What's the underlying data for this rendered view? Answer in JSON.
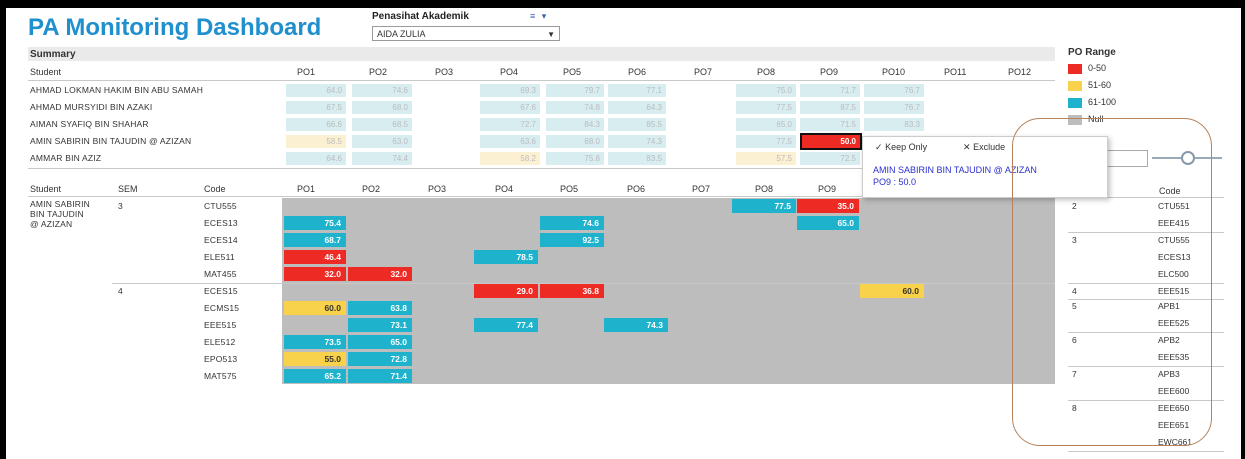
{
  "title": "PA Monitoring Dashboard",
  "filter": {
    "label": "Penasihat Akademik",
    "value": "AIDA ZULIA"
  },
  "summary": {
    "title": "Summary",
    "columns": [
      "Student",
      "PO1",
      "PO2",
      "PO3",
      "PO4",
      "PO5",
      "PO6",
      "PO7",
      "PO8",
      "PO9",
      "PO10",
      "PO11",
      "PO12"
    ],
    "rows": [
      {
        "name": "AHMAD LOKMAN HAKIM BIN ABU SAMAH",
        "values": [
          "64.0",
          "74.6",
          "",
          "69.3",
          "79.7",
          "77.1",
          "",
          "75.0",
          "71.7",
          "76.7",
          "",
          ""
        ]
      },
      {
        "name": "AHMAD MURSYIDI BIN AZAKI",
        "values": [
          "67.5",
          "68.0",
          "",
          "67.6",
          "74.8",
          "64.3",
          "",
          "77.5",
          "87.5",
          "76.7",
          "",
          ""
        ]
      },
      {
        "name": "AIMAN SYAFIQ BIN SHAHAR",
        "values": [
          "66.6",
          "68.5",
          "",
          "72.7",
          "84.3",
          "85.5",
          "",
          "65.0",
          "71.5",
          "83.3",
          "",
          ""
        ]
      },
      {
        "name": "AMIN SABIRIN BIN TAJUDIN @ AZIZAN",
        "values": [
          "58.5",
          "63.0",
          "",
          "63.6",
          "68.0",
          "74.3",
          "",
          "77.5",
          "50.0",
          "",
          "",
          ""
        ]
      },
      {
        "name": "AMMAR BIN AZIZ",
        "values": [
          "64.6",
          "74.4",
          "",
          "58.2",
          "75.8",
          "83.5",
          "",
          "57.5",
          "72.5",
          "",
          "",
          ""
        ]
      }
    ]
  },
  "detail": {
    "columns": [
      "Student",
      "SEM",
      "Code",
      "PO1",
      "PO2",
      "PO3",
      "PO4",
      "PO5",
      "PO6",
      "PO7",
      "PO8",
      "PO9"
    ],
    "student": "AMIN SABIRIN BIN TAJUDIN @ AZIZAN",
    "student_lines": [
      "AMIN SABIRIN",
      "BIN TAJUDIN",
      "@ AZIZAN"
    ],
    "sem3": "3",
    "sem4": "4",
    "codes": [
      "CTU555",
      "ECES13",
      "ECES14",
      "ELE511",
      "MAT455",
      "ECES15",
      "ECMS15",
      "EEE515",
      "ELE512",
      "EPO513",
      "MAT575"
    ],
    "values": {
      "ctu_po8": "77.5",
      "ctu_po9": "35.0",
      "ec513_po1": "75.4",
      "ec513_po5": "74.6",
      "ec513_po9": "65.0",
      "ec514_po1": "68.7",
      "ec514_po5": "92.5",
      "ele511_po1": "46.4",
      "ele511_po4": "78.5",
      "mat455_po1": "32.0",
      "mat455_po2": "32.0",
      "ec515_po4": "29.0",
      "ec515_po5": "36.8",
      "ec515_po10": "60.0",
      "ecm515_po1": "60.0",
      "ecm515_po2": "63.8",
      "eee515_po2": "73.1",
      "eee515_po4": "77.4",
      "eee515_po6": "74.3",
      "ele512_po1": "73.5",
      "ele512_po2": "65.0",
      "epo513_po1": "55.0",
      "epo513_po2": "72.8",
      "mat575_po1": "65.2",
      "mat575_po2": "71.4"
    }
  },
  "legend": {
    "title": "PO Range",
    "items": [
      {
        "label": "0-50",
        "color": "#ee2a24"
      },
      {
        "label": "51-60",
        "color": "#f8d24a"
      },
      {
        "label": "61-100",
        "color": "#1eb2cc"
      },
      {
        "label": "Null",
        "color": "#bdbdbd"
      }
    ]
  },
  "tooltip": {
    "keep_only": "Keep Only",
    "exclude": "Exclude",
    "name": "AMIN SABIRIN BIN TAJUDIN @ AZIZAN",
    "value_line": "PO9 :  50.0"
  },
  "right_panel": {
    "code_header": "Code",
    "groups": [
      {
        "sem": "2",
        "codes": [
          "CTU551",
          "EEE415"
        ]
      },
      {
        "sem": "3",
        "codes": [
          "CTU555",
          "ECES13",
          "ELC500"
        ]
      },
      {
        "sem": "4",
        "codes": [
          "EEE515"
        ]
      },
      {
        "sem": "5",
        "codes": [
          "APB1",
          "EEE525"
        ]
      },
      {
        "sem": "6",
        "codes": [
          "APB2",
          "EEE535"
        ]
      },
      {
        "sem": "7",
        "codes": [
          "APB3",
          "EEE600"
        ]
      },
      {
        "sem": "8",
        "codes": [
          "EEE650",
          "EEE651",
          "EWC661"
        ]
      }
    ]
  },
  "colors": {
    "red": "#ee2a24",
    "yellow": "#f8d24a",
    "cyan": "#1eb2cc",
    "null": "#bdbdbd",
    "title_blue": "#1f8fcd"
  }
}
